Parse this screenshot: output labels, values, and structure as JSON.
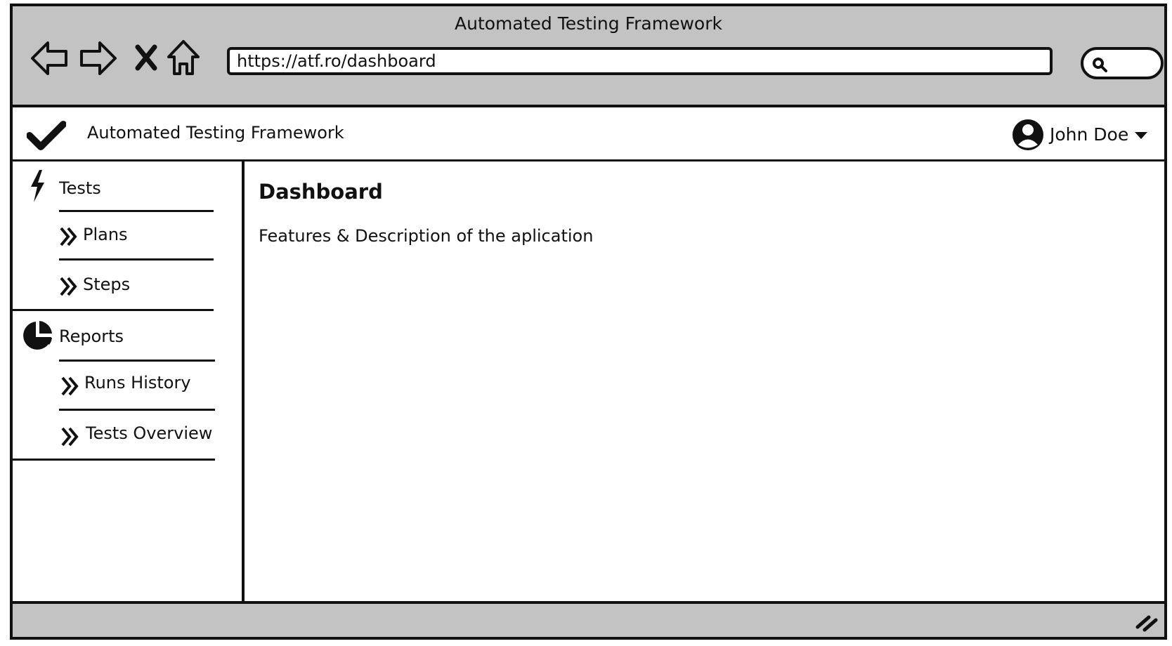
{
  "window": {
    "title": "Automated Testing Framework"
  },
  "browser": {
    "url": "https://atf.ro/dashboard",
    "icons": [
      "back-icon",
      "forward-icon",
      "stop-icon",
      "home-icon",
      "search-icon"
    ]
  },
  "header": {
    "title": "Automated Testing Framework",
    "logo_icon": "checkmark-icon",
    "user": {
      "name": "John Doe",
      "avatar_icon": "user-avatar-icon",
      "caret_icon": "caret-down-icon"
    }
  },
  "sidebar": {
    "sections": [
      {
        "label": "Tests",
        "icon": "lightning-icon",
        "items": [
          {
            "label": "Plans"
          },
          {
            "label": "Steps"
          }
        ]
      },
      {
        "label": "Reports",
        "icon": "pie-chart-icon",
        "items": [
          {
            "label": "Runs History"
          },
          {
            "label": "Tests Overview"
          }
        ]
      }
    ]
  },
  "main": {
    "title": "Dashboard",
    "description": "Features & Description of the aplication"
  },
  "colors": {
    "chrome": "#c3c3c3",
    "ink": "#111111",
    "background": "#ffffff"
  }
}
